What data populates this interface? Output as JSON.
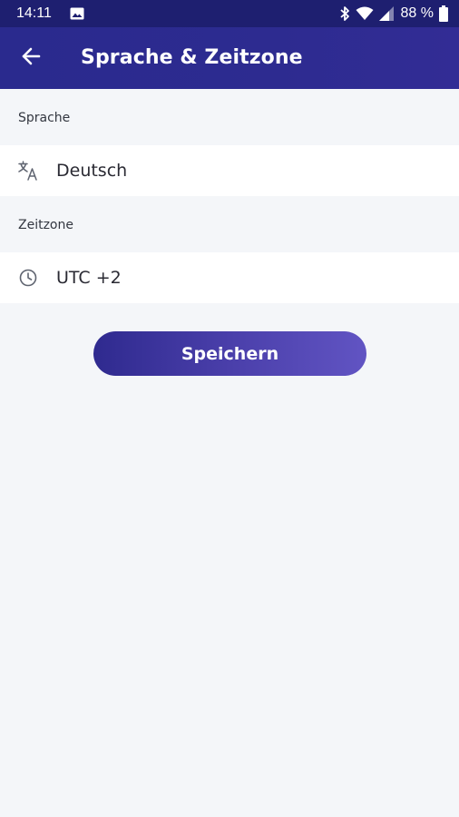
{
  "status_bar": {
    "time": "14:11",
    "battery": "88 %",
    "icons": [
      "image-icon",
      "bluetooth-icon",
      "wifi-icon",
      "signal-icon",
      "battery-icon"
    ]
  },
  "app_bar": {
    "title": "Sprache & Zeitzone",
    "back_icon": "arrow-left-icon",
    "background": "#2a2a8e"
  },
  "language": {
    "label": "Sprache",
    "value": "Deutsch",
    "icon": "translate-icon"
  },
  "timezone": {
    "label": "Zeitzone",
    "value": "UTC +2",
    "icon": "clock-icon"
  },
  "actions": {
    "save_label": "Speichern",
    "gradient_start": "#2f2a8f",
    "gradient_end": "#6154c3"
  }
}
